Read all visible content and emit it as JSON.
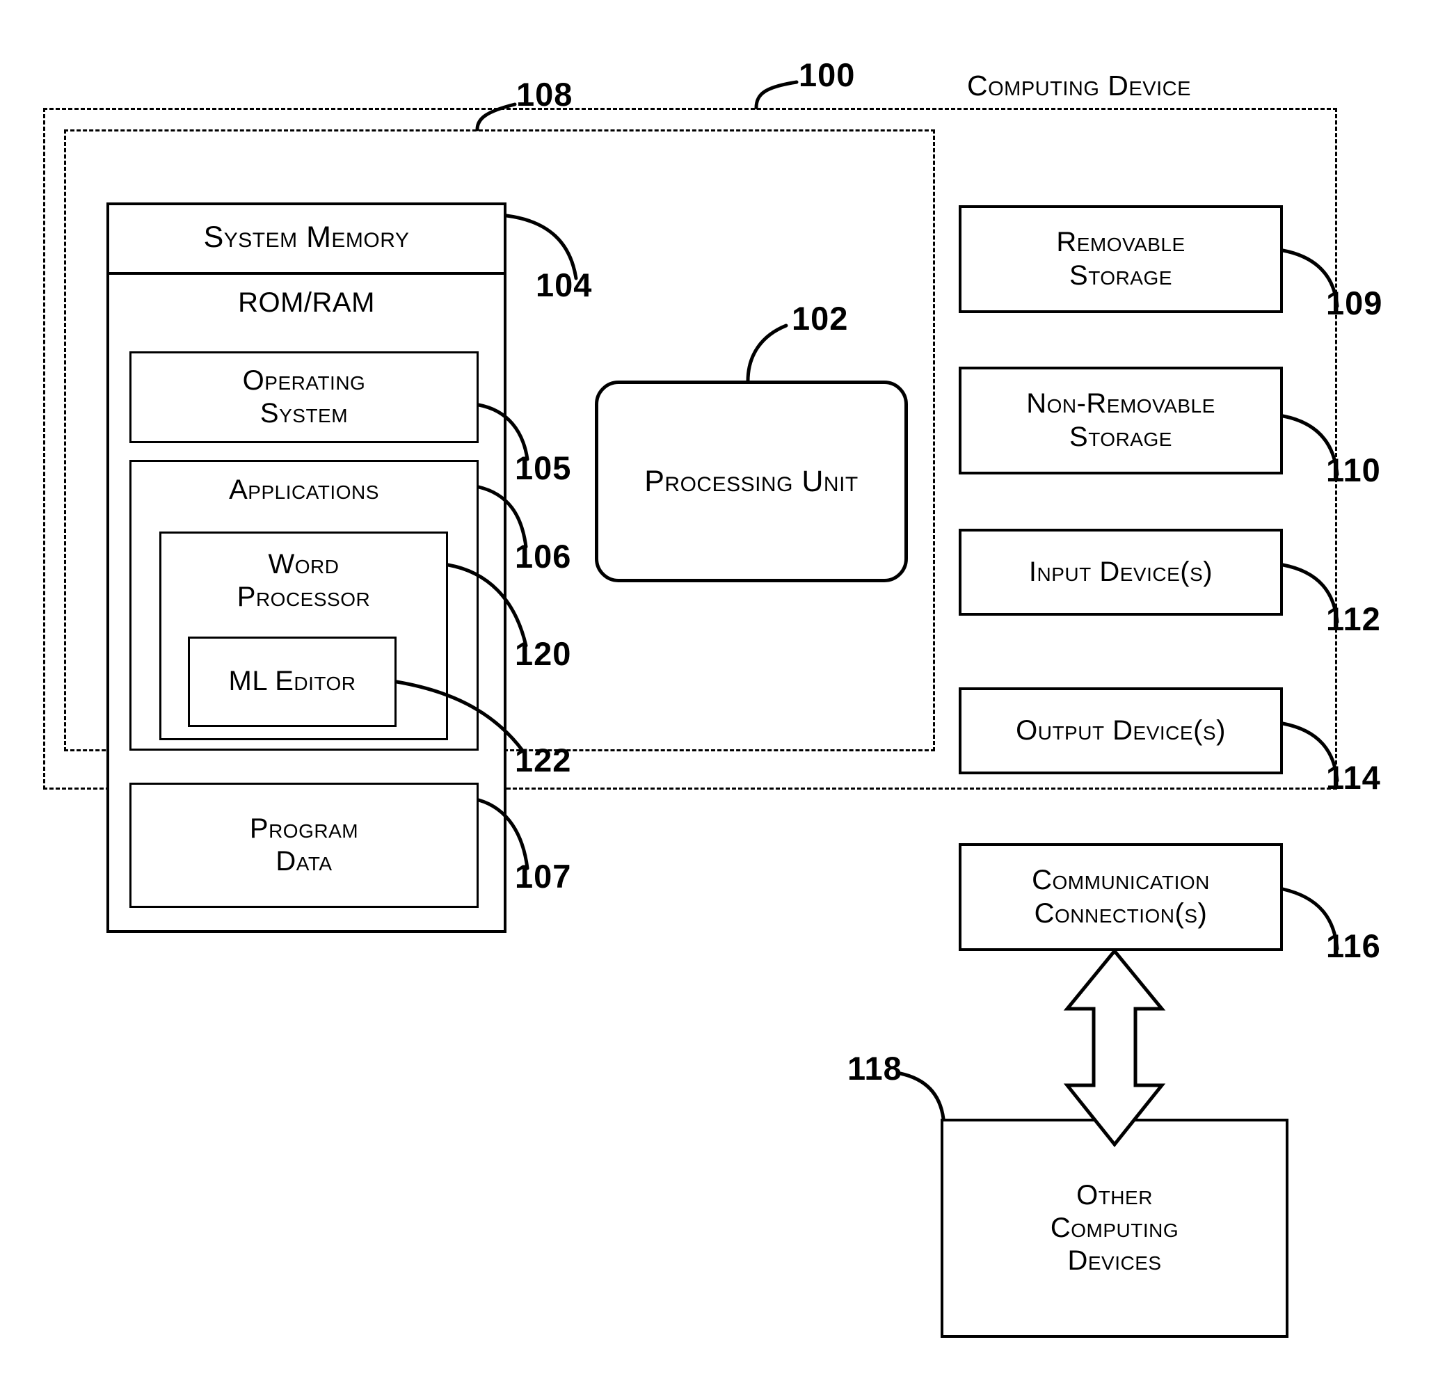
{
  "figure": {
    "title_label": "Computing Device",
    "outer_ref": "100",
    "inner_ref": "108"
  },
  "memory": {
    "system_memory_label": "System Memory",
    "system_memory_ref": "104",
    "rom_ram_label": "ROM/RAM",
    "operating_system_label": "Operating\nSystem",
    "operating_system_ref": "105",
    "applications_label": "Applications",
    "applications_ref": "106",
    "word_processor_label": "Word\nProcessor",
    "word_processor_ref": "120",
    "ml_editor_label": "ML Editor",
    "ml_editor_ref": "122",
    "program_data_label": "Program\nData",
    "program_data_ref": "107"
  },
  "processing": {
    "label": "Processing Unit",
    "ref": "102"
  },
  "peripherals": [
    {
      "label": "Removable\nStorage",
      "ref": "109"
    },
    {
      "label": "Non-Removable\nStorage",
      "ref": "110"
    },
    {
      "label": "Input Device(s)",
      "ref": "112"
    },
    {
      "label": "Output Device(s)",
      "ref": "114"
    },
    {
      "label": "Communication\nConnection(s)",
      "ref": "116"
    }
  ],
  "external": {
    "label": "Other\nComputing\nDevices",
    "ref": "118"
  },
  "colors": {
    "ink": "#000000",
    "paper": "#ffffff"
  }
}
